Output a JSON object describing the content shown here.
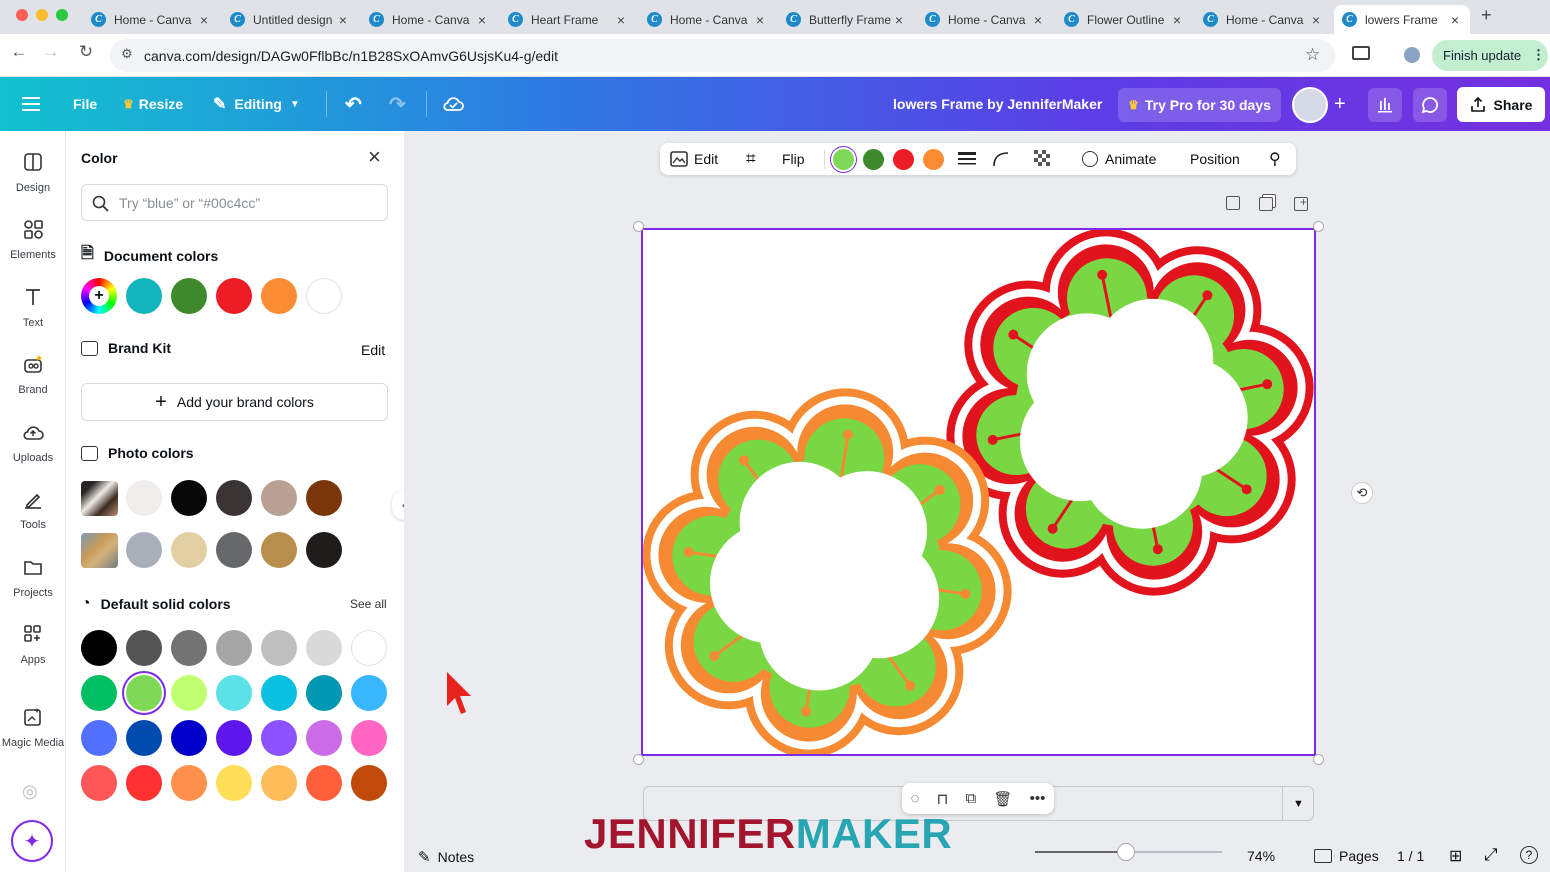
{
  "browser": {
    "tabs": [
      {
        "title": "Home - Canva"
      },
      {
        "title": "Untitled design"
      },
      {
        "title": "Home - Canva"
      },
      {
        "title": "Heart Frame"
      },
      {
        "title": "Home - Canva"
      },
      {
        "title": "Butterfly Frame"
      },
      {
        "title": "Home - Canva"
      },
      {
        "title": "Flower Outline"
      },
      {
        "title": "Home - Canva"
      },
      {
        "title": "lowers Frame"
      }
    ],
    "new_tab_label": "+",
    "url": "canva.com/design/DAGw0FflbBc/n1B28SxOAmvG6UsjsKu4-g/edit",
    "finish_update_label": "Finish update"
  },
  "topbar": {
    "file_label": "File",
    "resize_label": "Resize",
    "editing_label": "Editing",
    "design_title": "lowers Frame by JenniferMaker",
    "try_pro_label": "Try Pro for 30 days",
    "share_label": "Share"
  },
  "rail": {
    "items": [
      {
        "label": "Design",
        "icon": "design-icon"
      },
      {
        "label": "Elements",
        "icon": "elements-icon"
      },
      {
        "label": "Text",
        "icon": "text-icon"
      },
      {
        "label": "Brand",
        "icon": "brand-icon"
      },
      {
        "label": "Uploads",
        "icon": "uploads-icon"
      },
      {
        "label": "Tools",
        "icon": "tools-icon"
      },
      {
        "label": "Projects",
        "icon": "projects-icon"
      },
      {
        "label": "Apps",
        "icon": "apps-icon"
      },
      {
        "label": "Magic Media",
        "icon": "magic-media-icon"
      }
    ]
  },
  "panel": {
    "title": "Color",
    "search_placeholder": "Try “blue” or “#00c4cc”",
    "document_colors_label": "Document colors",
    "document_colors": [
      "#0fb5ba",
      "#3e8a2b",
      "#ee1c25",
      "#fb8c34",
      "#ffffff"
    ],
    "brand_kit_label": "Brand Kit",
    "brand_kit_edit": "Edit",
    "add_brand_colors_label": "Add your brand colors",
    "photo_colors_label": "Photo colors",
    "photo_colors_row1": [
      "#efecea",
      "#080808",
      "#3b3435",
      "#b8a193",
      "#7a3508"
    ],
    "photo_colors_row2": [
      "#a7b0b8",
      "#e2cfa3",
      "#666869",
      "#b78e4c",
      "#1f1d1b"
    ],
    "default_colors_label": "Default solid colors",
    "see_all_label": "See all",
    "default_colors": [
      [
        "#000000",
        "#545454",
        "#737373",
        "#a6a6a6",
        "#bfbfbf",
        "#d9d9d9",
        "#ffffff"
      ],
      [
        "#00bf63",
        "#7ed957",
        "#c1ff72",
        "#5ce1e6",
        "#0cc0df",
        "#0097b2",
        "#38b6ff"
      ],
      [
        "#5170ff",
        "#004aad",
        "#0000c8",
        "#5e17eb",
        "#8c52ff",
        "#cb6ce6",
        "#ff66c4"
      ],
      [
        "#ff5757",
        "#ff3131",
        "#ff914d",
        "#ffde59",
        "#ffbd59",
        "#ff5f3a",
        "#c04a0a"
      ]
    ],
    "selected_default_color": "#7ed957"
  },
  "context_toolbar": {
    "edit_label": "Edit",
    "flip_label": "Flip",
    "colors": [
      "#7ed957",
      "#3e8a2b",
      "#ee1c25",
      "#fb8c34"
    ],
    "animate_label": "Animate",
    "position_label": "Position"
  },
  "bottom": {
    "notes_label": "Notes",
    "watermark_dark": "JENNIFER",
    "watermark_teal": "MAKER",
    "zoom": "74%",
    "zoom_fraction": 0.74,
    "pages_label": "Pages",
    "page_count": "1 / 1"
  }
}
